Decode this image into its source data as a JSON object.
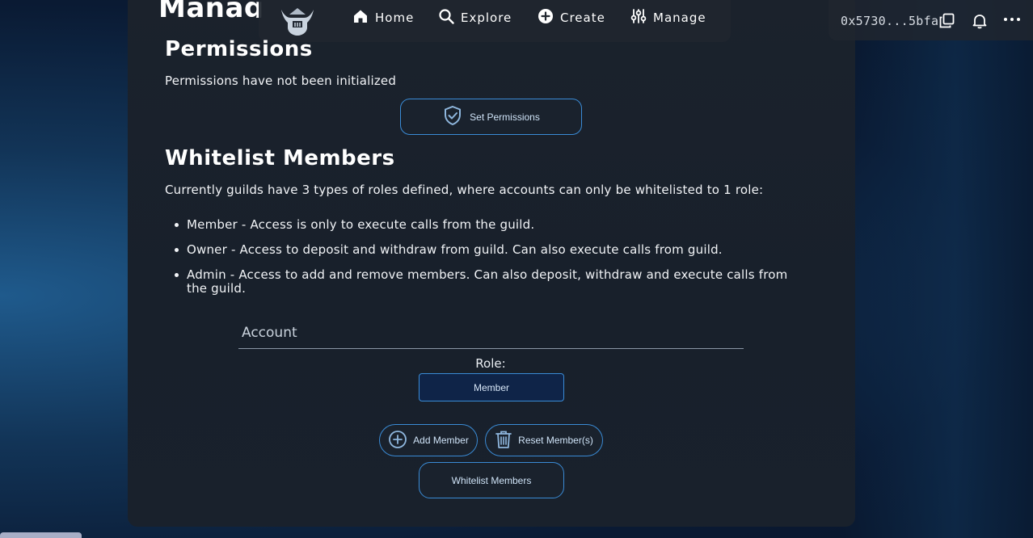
{
  "page": {
    "title": "Manag"
  },
  "nav": {
    "items": [
      {
        "label": "Home",
        "icon": "home-icon"
      },
      {
        "label": "Explore",
        "icon": "search-icon"
      },
      {
        "label": "Create",
        "icon": "plus-circle-icon"
      },
      {
        "label": "Manage",
        "icon": "sliders-icon"
      }
    ]
  },
  "account": {
    "address": "0x5730...5bfa"
  },
  "permissions": {
    "heading": "Permissions",
    "status": "Permissions have not been initialized",
    "button_label": "Set Permissions"
  },
  "whitelist": {
    "heading": "Whitelist Members",
    "description": "Currently guilds have 3 types of roles defined, where accounts can only be whitelisted to 1 role:",
    "roles": [
      "Member - Access is only to execute calls from the guild.",
      "Owner - Access to deposit and withdraw from guild. Can also execute calls from guild.",
      "Admin - Access to add and remove members. Can also deposit, withdraw and execute calls from the guild."
    ],
    "account_placeholder": "Account",
    "role_label": "Role:",
    "role_selected": "Member",
    "add_member_label": "Add Member",
    "reset_members_label": "Reset Member(s)",
    "whitelist_button_label": "Whitelist Members"
  },
  "colors": {
    "accent_border": "#3a8bd6",
    "panel": "#1b222c",
    "select_bg": "#0f2448"
  }
}
